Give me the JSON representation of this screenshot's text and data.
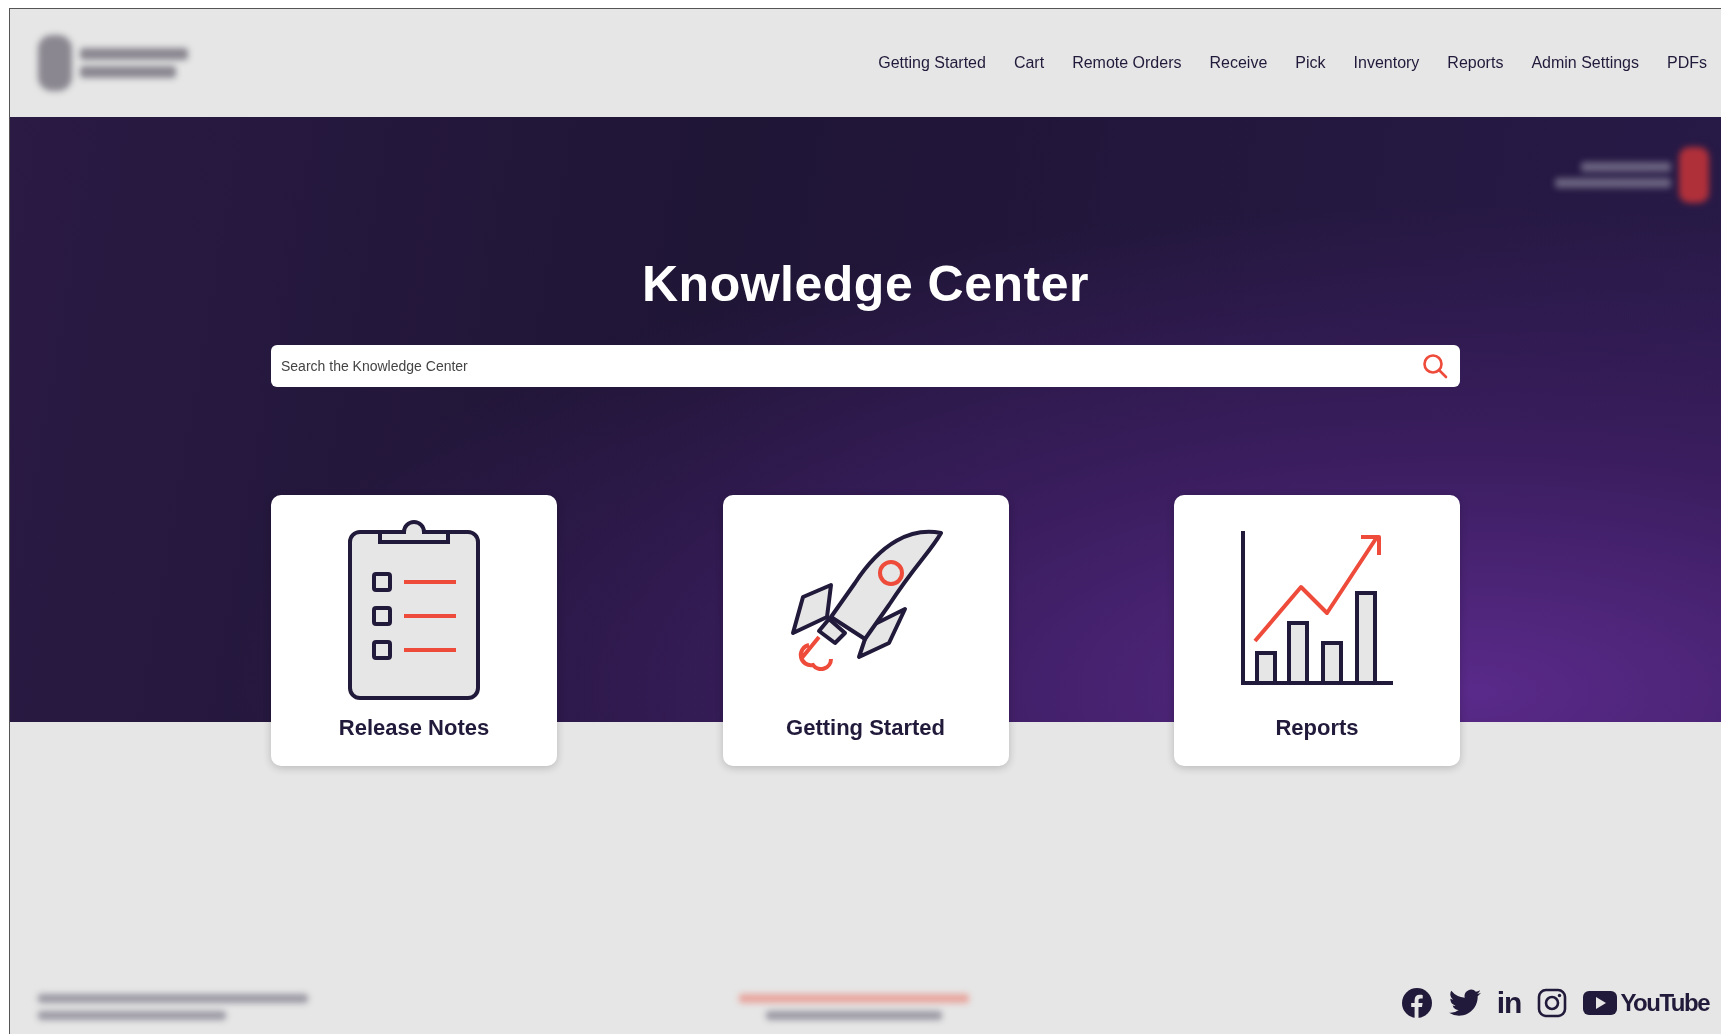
{
  "nav": {
    "items": [
      {
        "label": "Getting Started"
      },
      {
        "label": "Cart"
      },
      {
        "label": "Remote Orders"
      },
      {
        "label": "Receive"
      },
      {
        "label": "Pick"
      },
      {
        "label": "Inventory"
      },
      {
        "label": "Reports"
      },
      {
        "label": "Admin Settings"
      },
      {
        "label": "PDFs"
      }
    ]
  },
  "hero": {
    "title": "Knowledge Center",
    "search": {
      "placeholder": "Search the Knowledge Center"
    }
  },
  "cards": [
    {
      "kind": "clipboard",
      "label": "Release Notes"
    },
    {
      "kind": "rocket",
      "label": "Getting Started"
    },
    {
      "kind": "chart",
      "label": "Reports"
    }
  ],
  "footer": {
    "social": [
      {
        "kind": "facebook"
      },
      {
        "kind": "twitter"
      },
      {
        "kind": "linkedin",
        "label": "in"
      },
      {
        "kind": "instagram"
      },
      {
        "kind": "youtube",
        "label": "YouTube"
      }
    ]
  }
}
